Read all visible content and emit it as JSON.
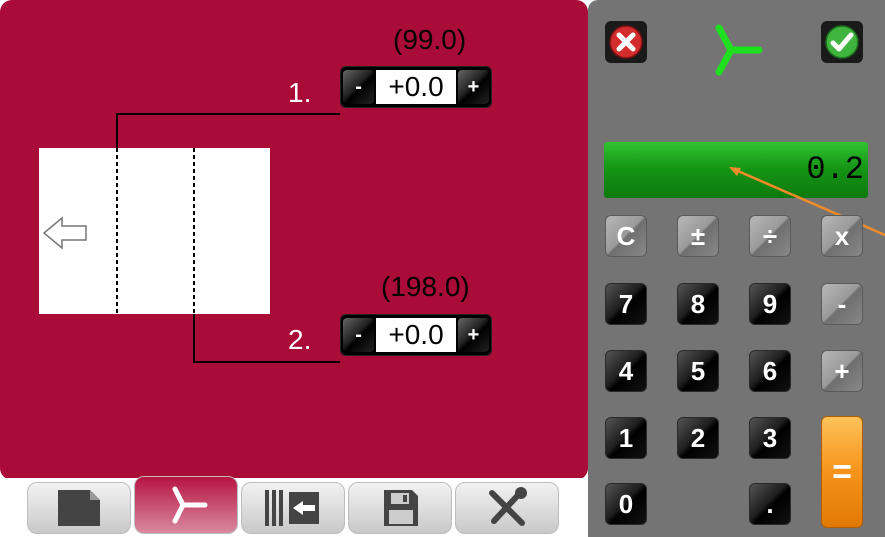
{
  "folds": [
    {
      "number": "1.",
      "reference": "(99.0)",
      "value": "+0.0",
      "minus": "-",
      "plus": "+"
    },
    {
      "number": "2.",
      "reference": "(198.0)",
      "value": "+0.0",
      "minus": "-",
      "plus": "+"
    }
  ],
  "tabs": [
    "sheet-icon",
    "fold-icon",
    "backgauge-icon",
    "save-icon",
    "tools-icon"
  ],
  "calculator": {
    "display": "0.2",
    "keys": {
      "clear": "C",
      "plusminus": "±",
      "divide": "÷",
      "multiply": "x",
      "k7": "7",
      "k8": "8",
      "k9": "9",
      "minus": "-",
      "k4": "4",
      "k5": "5",
      "k6": "6",
      "plus": "+",
      "k1": "1",
      "k2": "2",
      "k3": "3",
      "equals": "=",
      "k0": "0",
      "dot": "."
    }
  },
  "colors": {
    "panel": "#a80c37",
    "calculator": "#747474",
    "display": "#18a218",
    "equals": "#f59a1a"
  }
}
